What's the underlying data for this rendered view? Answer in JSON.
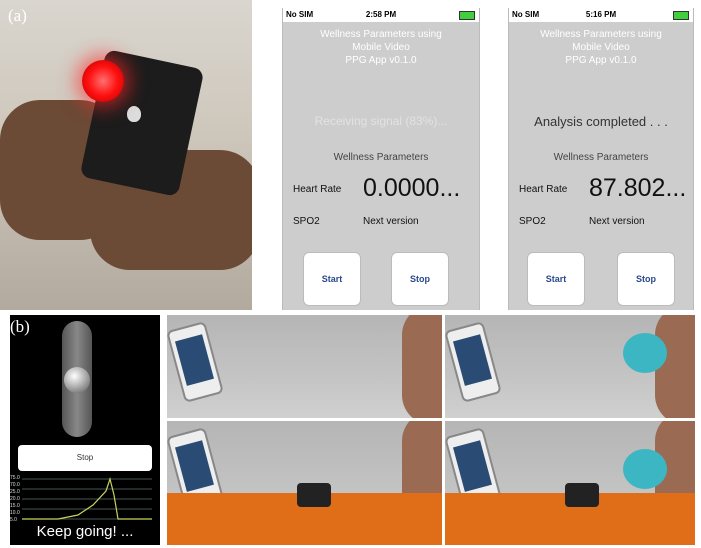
{
  "panel_a": {
    "label": "(a)"
  },
  "panel_b": {
    "label": "(b)"
  },
  "screens": [
    {
      "carrier": "No SIM",
      "time": "2:58 PM",
      "title_lines": [
        "Wellness Parameters using",
        "Mobile Video",
        "PPG App v0.1.0"
      ],
      "status": "Receiving signal (83%)...",
      "section": "Wellness Parameters",
      "heart_rate_label": "Heart Rate",
      "heart_rate_value": "0.0000...",
      "spo2_label": "SPO2",
      "spo2_value": "Next version",
      "start_label": "Start",
      "stop_label": "Stop"
    },
    {
      "carrier": "No SIM",
      "time": "5:16 PM",
      "title_lines": [
        "Wellness Parameters using",
        "Mobile Video",
        "PPG App v0.1.0"
      ],
      "status": "Analysis completed . . .",
      "section": "Wellness Parameters",
      "heart_rate_label": "Heart Rate",
      "heart_rate_value": "87.802...",
      "spo2_label": "SPO2",
      "spo2_value": "Next version",
      "start_label": "Start",
      "stop_label": "Stop"
    }
  ],
  "breath_app": {
    "stop_label": "Stop",
    "message": "Keep going! ...",
    "y_ticks": [
      "75.0",
      "70.0",
      "25.0",
      "20.0",
      "15.0",
      "10.0",
      "5.0",
      "0.0"
    ]
  },
  "colors": {
    "screen_bg": "#cdcdcd",
    "button_text": "#2b4a8c",
    "battery": "#3fcf3f",
    "belt": "#e06d18",
    "mouthpiece": "#3cb6c3"
  }
}
